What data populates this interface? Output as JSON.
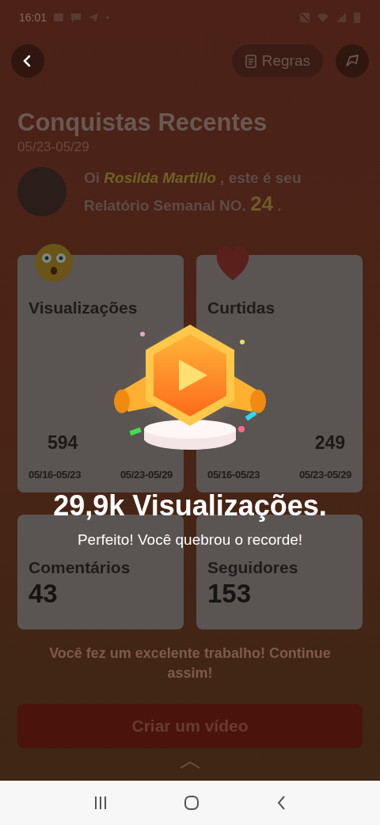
{
  "status_bar": {
    "time": "16:01"
  },
  "header": {
    "rules_button": "Regras"
  },
  "title": "Conquistas Recentes",
  "date_range": "05/23-05/29",
  "greeting": {
    "prefix": "Oi",
    "user_name": "Rosilda Martillo",
    "middle": ", este é seu Relatório Semanal NO.",
    "report_number": "24",
    "suffix": "."
  },
  "stats": [
    {
      "kind": "comparison",
      "label": "Visualizações",
      "previous_value": "594",
      "periods": [
        "05/16-05/23",
        "05/23-05/29"
      ]
    },
    {
      "kind": "comparison",
      "label": "Curtidas",
      "current_value": "249",
      "periods": [
        "05/16-05/23",
        "05/23-05/29"
      ]
    },
    {
      "kind": "total",
      "label": "Comentários",
      "value": "43"
    },
    {
      "kind": "total",
      "label": "Seguidores",
      "value": "153"
    }
  ],
  "footer_message": "Você fez um excelente trabalho! Continue assim!",
  "cta_button": "Criar um vídeo",
  "popup": {
    "headline": "29,9k Visualizações.",
    "message": "Perfeito! Você quebrou o recorde!"
  }
}
